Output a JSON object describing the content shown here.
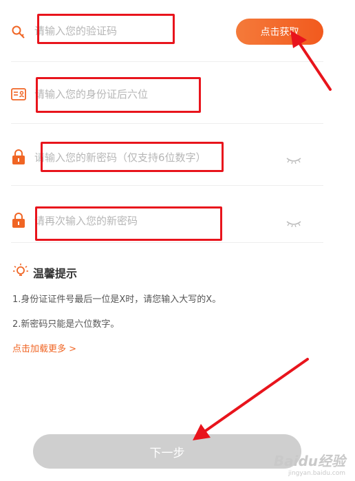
{
  "form": {
    "code_placeholder": "请输入您的验证码",
    "get_code_label": "点击获取",
    "id_placeholder": "请输入您的身份证后六位",
    "new_pwd_placeholder": "请输入您的新密码（仅支持6位数字）",
    "confirm_pwd_placeholder": "请再次输入您的新密码"
  },
  "tips": {
    "title": "温馨提示",
    "items": [
      "1.身份证证件号最后一位是X时，请您输入大写的X。",
      "2.新密码只能是六位数字。"
    ],
    "more_label": "点击加载更多 >"
  },
  "next_label": "下一步",
  "watermark": {
    "main": "Baidu经验",
    "sub": "jingyan.baidu.com"
  },
  "colors": {
    "accent": "#f25a1e",
    "annotation": "#e8141c",
    "disabled": "#cfcfcf"
  },
  "icons": [
    "key-icon",
    "id-card-icon",
    "lock-icon",
    "eye-closed-icon",
    "bulb-icon"
  ]
}
